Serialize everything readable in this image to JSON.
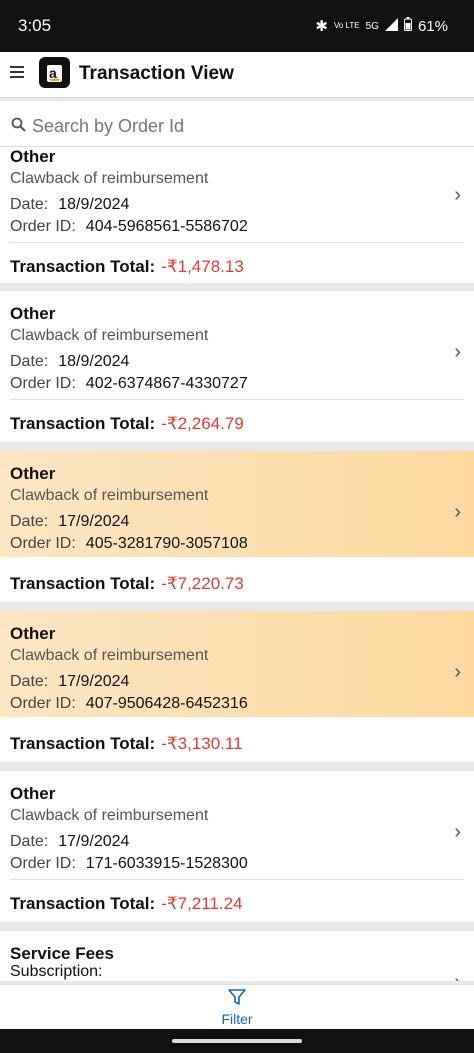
{
  "status_bar": {
    "time": "3:05",
    "network_small": "Vo LTE",
    "network": "5G",
    "battery": "61%"
  },
  "app": {
    "title": "Transaction View"
  },
  "search": {
    "placeholder": "Search by Order Id"
  },
  "labels": {
    "date": "Date:",
    "order_id": "Order ID:",
    "total": "Transaction Total:"
  },
  "transactions": [
    {
      "category": "Other",
      "description": "Clawback of reimbursement",
      "date": "18/9/2024",
      "order_id": "404-5968561-5586702",
      "total": "-₹1,478.13",
      "highlighted": false
    },
    {
      "category": "Other",
      "description": "Clawback of reimbursement",
      "date": "18/9/2024",
      "order_id": "402-6374867-4330727",
      "total": "-₹2,264.79",
      "highlighted": false
    },
    {
      "category": "Other",
      "description": "Clawback of reimbursement",
      "date": "17/9/2024",
      "order_id": "405-3281790-3057108",
      "total": "-₹7,220.73",
      "highlighted": true
    },
    {
      "category": "Other",
      "description": "Clawback of reimbursement",
      "date": "17/9/2024",
      "order_id": "407-9506428-6452316",
      "total": "-₹3,130.11",
      "highlighted": true
    },
    {
      "category": "Other",
      "description": "Clawback of reimbursement",
      "date": "17/9/2024",
      "order_id": "171-6033915-1528300",
      "total": "-₹7,211.24",
      "highlighted": false
    },
    {
      "category": "Service Fees",
      "description": "Subscription:"
    }
  ],
  "bottom": {
    "filter_label": "Filter"
  },
  "colors": {
    "negative": "#e53935",
    "highlight": "#fdd9a0",
    "accent": "#1565c0"
  }
}
